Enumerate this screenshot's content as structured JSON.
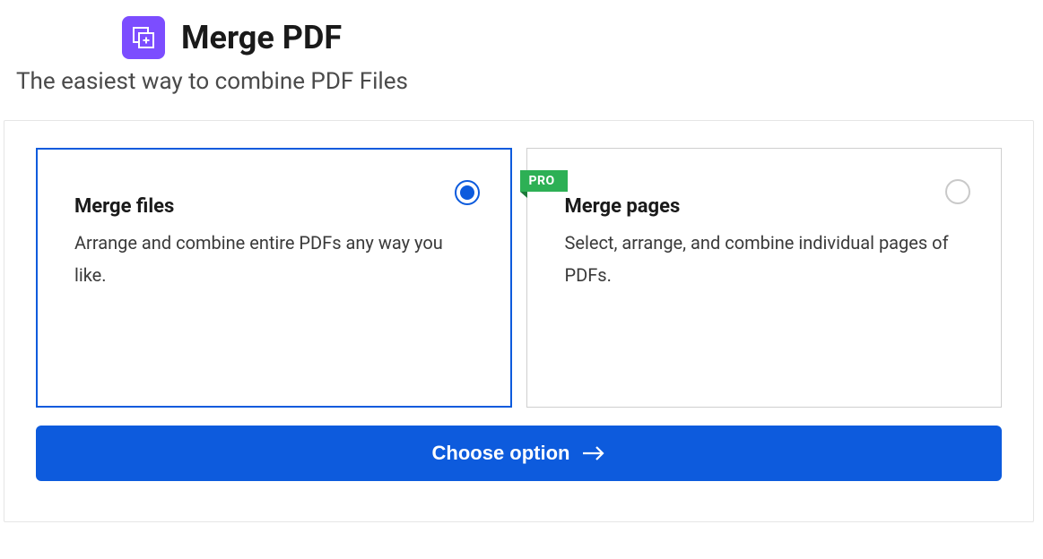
{
  "header": {
    "title": "Merge PDF",
    "subtitle": "The easiest way to combine PDF Files"
  },
  "options": {
    "merge_files": {
      "title": "Merge files",
      "description": "Arrange and combine entire PDFs any way you like."
    },
    "merge_pages": {
      "title": "Merge pages",
      "description": "Select, arrange, and combine individual pages of PDFs.",
      "badge": "PRO"
    }
  },
  "action": {
    "choose_label": "Choose option"
  }
}
